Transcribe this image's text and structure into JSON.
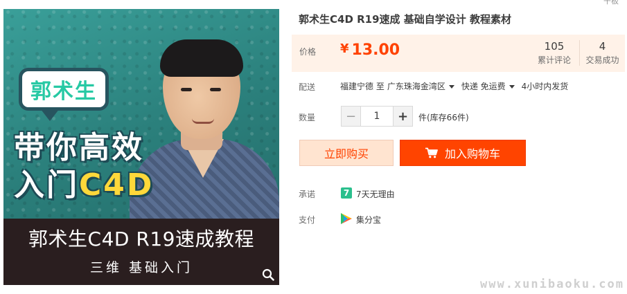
{
  "corner_label": "干板",
  "image": {
    "name_tag": "郭术生",
    "headline_line1": "带你高效",
    "headline_line2_prefix": "入门",
    "headline_line2_accent": "C4D",
    "banner_title": "郭术生C4D R19速成教程",
    "banner_subtitle": "三维 基础入门"
  },
  "product": {
    "title": "郭术生C4D R19速成 基础自学设计 教程素材"
  },
  "price": {
    "label": "价格",
    "currency": "¥",
    "amount": "13.00",
    "reviews_count": "105",
    "reviews_label": "累计评论",
    "sales_count": "4",
    "sales_label": "交易成功"
  },
  "shipping": {
    "label": "配送",
    "origin": "福建宁德 至",
    "destination": "广东珠海金湾区",
    "method": "快递 免运费",
    "dispatch": "4小时内发货"
  },
  "quantity": {
    "label": "数量",
    "value": "1",
    "stock_note": "件(库存66件)"
  },
  "actions": {
    "buy_now": "立即购买",
    "add_to_cart": "加入购物车"
  },
  "promise": {
    "label": "承诺",
    "icon_text": "7",
    "value": "7天无理由"
  },
  "payment": {
    "label": "支付",
    "value": "集分宝"
  },
  "watermark": "www.xunibaoku.com",
  "colors": {
    "accent": "#ff4400",
    "price": "#ff4200",
    "price_panel_bg": "#fff2e8",
    "promise_icon": "#2bbf8d"
  }
}
